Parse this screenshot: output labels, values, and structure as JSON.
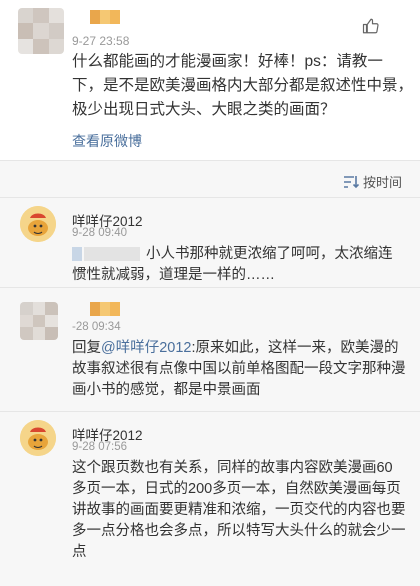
{
  "post": {
    "timestamp": "9-27 23:58",
    "lines": [
      "什么都能画的才能漫画家！好棒！ps：请教一",
      "下，是不是欧美漫画格内大部分都是叙述性中景，",
      "极少出现日式大头、大眼之类的画面？"
    ],
    "view_link": "查看原微博"
  },
  "sort": {
    "label": "按时间"
  },
  "replies": [
    {
      "name": "咩咩仔2012",
      "timestamp": "9-28 09:40",
      "lines": [
        "小人书那种就更浓缩了呵呵，太浓缩连",
        "惯性就减弱，道理是一样的……"
      ]
    },
    {
      "name": "",
      "timestamp": "-28 09:34",
      "prefix": "回复",
      "mention": "@咩咩仔2012",
      "first_line_rest": ":原来如此，这样一来，欧美漫的",
      "lines": [
        "故事叙述很有点像中国以前单格图配一段文字那种漫",
        "画小书的感觉，都是中景画面"
      ]
    },
    {
      "name": "咩咩仔2012",
      "timestamp": "9-28 07:56",
      "lines": [
        "这个跟页数也有关系，同样的故事内容欧美漫画60",
        "多页一本，日式的200多页一本，自然欧美漫画每页",
        "讲故事的画面要更精准和浓缩，一页交代的内容也要",
        "多一点分格也会多点，所以特写大头什么的就会少一",
        "点"
      ]
    }
  ],
  "colors": {
    "link": "#4a6f9c",
    "avatar_bg": "#f5d58a",
    "accent_orange": "#f0a33c"
  },
  "icons": {
    "like": "thumbs-up-icon",
    "sort": "sort-lines-icon"
  }
}
